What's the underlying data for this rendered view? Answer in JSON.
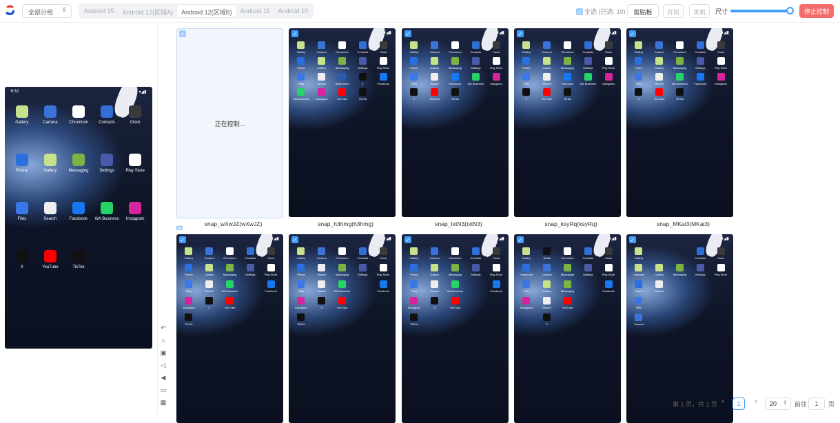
{
  "toolbar": {
    "group_select": "全部分组",
    "tabs": [
      {
        "label": "Android 15",
        "active": false
      },
      {
        "label": "Android 12(区域A)",
        "active": false
      },
      {
        "label": "Android 12(区域B)",
        "active": true
      },
      {
        "label": "Android 11",
        "active": false
      },
      {
        "label": "Android 10",
        "active": false
      }
    ],
    "select_all": "全选 (已选: 10)",
    "clipboard": "剪贴板",
    "power_on": "开机",
    "power_off": "关机",
    "size_label": "尺寸",
    "size_value_fraction": 1.0,
    "stop_control": "停止控制",
    "accent_color": "#409eff",
    "danger_color": "#f56c6c"
  },
  "preview": {
    "time": "6:32",
    "apps": [
      "Gallery",
      "Camera",
      "Chromium",
      "Contacts",
      "Clock",
      "Phone",
      "Gallery",
      "Messaging",
      "Settings",
      "Play Store",
      "Files",
      "Search",
      "Facebook",
      "WA Business",
      "Instagram",
      "X",
      "YouTube",
      "TikTok"
    ]
  },
  "side_tools": [
    "back-icon",
    "home-icon",
    "recents-icon",
    "volume-down-icon",
    "volume-up-icon",
    "screen-icon",
    "grid-icon"
  ],
  "devices": [
    {
      "name": "snap_wXwJZ(wXwJZ)",
      "controlling": true,
      "controlling_text": "正在控制...",
      "crown": true,
      "apps": []
    },
    {
      "name": "snap_h3hmg(h3hmg)",
      "apps": [
        "Gallery",
        "Camera",
        "Chromium",
        "Contacts",
        "Clock",
        "Phone",
        "Gallery",
        "Messaging",
        "Settings",
        "Play Store",
        "Files",
        "Search",
        "dump tools",
        "X",
        "Facebook",
        "WA Business",
        "Instagram",
        "YouTube",
        "TikTok"
      ]
    },
    {
      "name": "snap_txtN3(txtN3)",
      "apps": [
        "Gallery",
        "Camera",
        "Chromium",
        "Contacts",
        "Clock",
        "Phone",
        "Gallery",
        "Messaging",
        "Settings",
        "Play Store",
        "Files",
        "Search",
        "Facebook",
        "WA Business",
        "Instagram",
        "X",
        "YouTube",
        "TikTok"
      ]
    },
    {
      "name": "snap_ksyRq(ksyRq)",
      "apps": [
        "Gallery",
        "Camera",
        "Chromium",
        "Contacts",
        "Clock",
        "Phone",
        "Gallery",
        "Messaging",
        "Settings",
        "Play Store",
        "Files",
        "Search",
        "Facebook",
        "WA Business",
        "Instagram",
        "X",
        "YouTube",
        "TikTok"
      ]
    },
    {
      "name": "snap_MKai3(MKai3)",
      "apps": [
        "Gallery",
        "Camera",
        "Chromium",
        "Contacts",
        "Clock",
        "Phone",
        "Gallery",
        "Messaging",
        "Settings",
        "Play Store",
        "Files",
        "Search",
        "WA Business",
        "Facebook",
        "Instagram",
        "X",
        "YouTube",
        "TikTok"
      ]
    },
    {
      "name": "",
      "apps": [
        "Gallery",
        "Camera",
        "Chromium",
        "Contacts",
        "Clock",
        "Phone",
        "Gallery",
        "Messaging",
        "Settings",
        "Play Store",
        "Files",
        "Search",
        "WA Business",
        "",
        "Facebook",
        "Instagram",
        "X",
        "YouTube",
        "",
        "",
        "TikTok"
      ]
    },
    {
      "name": "",
      "apps": [
        "Gallery",
        "Camera",
        "Chromium",
        "Contacts",
        "Clock",
        "Phone",
        "Search",
        "Messaging",
        "Settings",
        "Play Store",
        "Files",
        "Search",
        "WA Business",
        "",
        "Facebook",
        "Instagram",
        "X",
        "YouTube",
        "",
        "",
        "TikTok"
      ]
    },
    {
      "name": "",
      "apps": [
        "Gallery",
        "Camera",
        "Chromium",
        "Contacts",
        "Clock",
        "Phone",
        "Gallery",
        "Messaging",
        "Settings",
        "Play Store",
        "Files",
        "Search",
        "WA Business",
        "",
        "Facebook",
        "Instagram",
        "X",
        "YouTube",
        "",
        "",
        "TikTok"
      ]
    },
    {
      "name": "",
      "apps": [
        "Gallery",
        "TikTok",
        "Chromium",
        "Contacts",
        "Clock",
        "Telephone",
        "Camera",
        "Messaging",
        "Settings",
        "Play Store",
        "Files",
        "Gallery",
        "Messaging",
        "",
        "Facebook",
        "Instagram",
        "Search",
        "YouTube",
        "",
        "",
        "",
        "X"
      ]
    },
    {
      "name": "",
      "apps": [
        "Gallery",
        "",
        "",
        "Contacts",
        "Clock",
        "Calendar",
        "Gallery",
        "Messaging",
        "Settings",
        "Play Store",
        "Phone",
        "Search",
        "",
        "",
        "",
        "Files",
        "",
        "",
        "",
        "",
        "Camera"
      ]
    }
  ],
  "pagination": {
    "total": "第 1 页，共 1 页",
    "current": "1",
    "page_size": "20",
    "goto_label": "前往",
    "goto_value": "1",
    "page_suffix": "页"
  },
  "icon_colors": {
    "Gallery": "#c6e28a",
    "Camera": "#3b73d9",
    "Chromium": "#ffffff",
    "Contacts": "#2f6fd6",
    "Clock": "#3a3a3a",
    "Phone": "#2a6fe0",
    "Messaging": "#7cb342",
    "Settings": "#4b5aa8",
    "Play Store": "#ffffff",
    "Files": "#3b78e7",
    "Search": "#eeeeee",
    "Facebook": "#1877f2",
    "WA Business": "#25d366",
    "Instagram": "#d6249f",
    "X": "#111111",
    "YouTube": "#ff0000",
    "TikTok": "#111111",
    "dump tools": "#2a5db0",
    "Telephone": "#2a6fe0",
    "Calendar": "#c6e28a"
  }
}
